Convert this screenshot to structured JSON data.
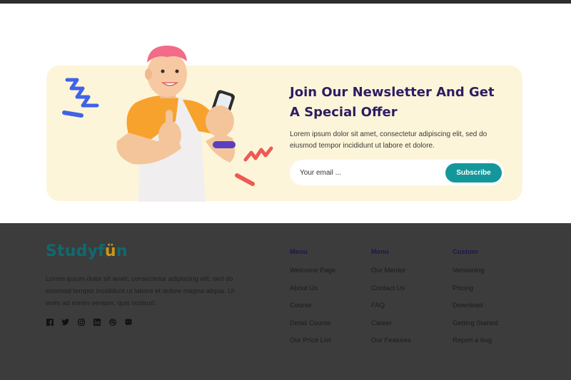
{
  "colors": {
    "newsletter_bg": "#fdf5d9",
    "title": "#2b1d63",
    "subscribe_button": "#14979b",
    "footer_bg": "#3c3c3c",
    "logo_primary": "#0f6a70",
    "logo_accent": "#c69a1a"
  },
  "newsletter": {
    "title": "Join Our Newsletter And Get A Special Offer",
    "description": "Lorem ipsum dolor sit amet, consectetur adipiscing elit, sed do eiusmod tempor incididunt ut labore et dolore.",
    "email_placeholder": "Your email ...",
    "subscribe_label": "Subscribe"
  },
  "footer": {
    "logo_text": "Studyf",
    "logo_accent": "ü",
    "logo_end": "n",
    "description": "Lorem ipsum dolor sit amet, consectetur adipiscing elit, sed do eiusmod tempor incididunt ut labore et dolore magna aliqua. Ut enim ad minim veniam, quis nostrud.",
    "socials": [
      "facebook-icon",
      "twitter-icon",
      "instagram-icon",
      "linkedin-icon",
      "dribbble-icon",
      "discord-icon"
    ],
    "columns": [
      {
        "title": "Menu",
        "links": [
          "Welcome Page",
          "About Us",
          "Course",
          "Detail Course",
          "Our Price List"
        ]
      },
      {
        "title": "Menu",
        "links": [
          "Our Mentor",
          "Contact Us",
          "FAQ",
          "Career",
          "Our Features"
        ]
      },
      {
        "title": "Custom",
        "links": [
          "Versioning",
          "Pricing",
          "Download",
          "Getting Started",
          "Report a bug"
        ]
      }
    ]
  }
}
